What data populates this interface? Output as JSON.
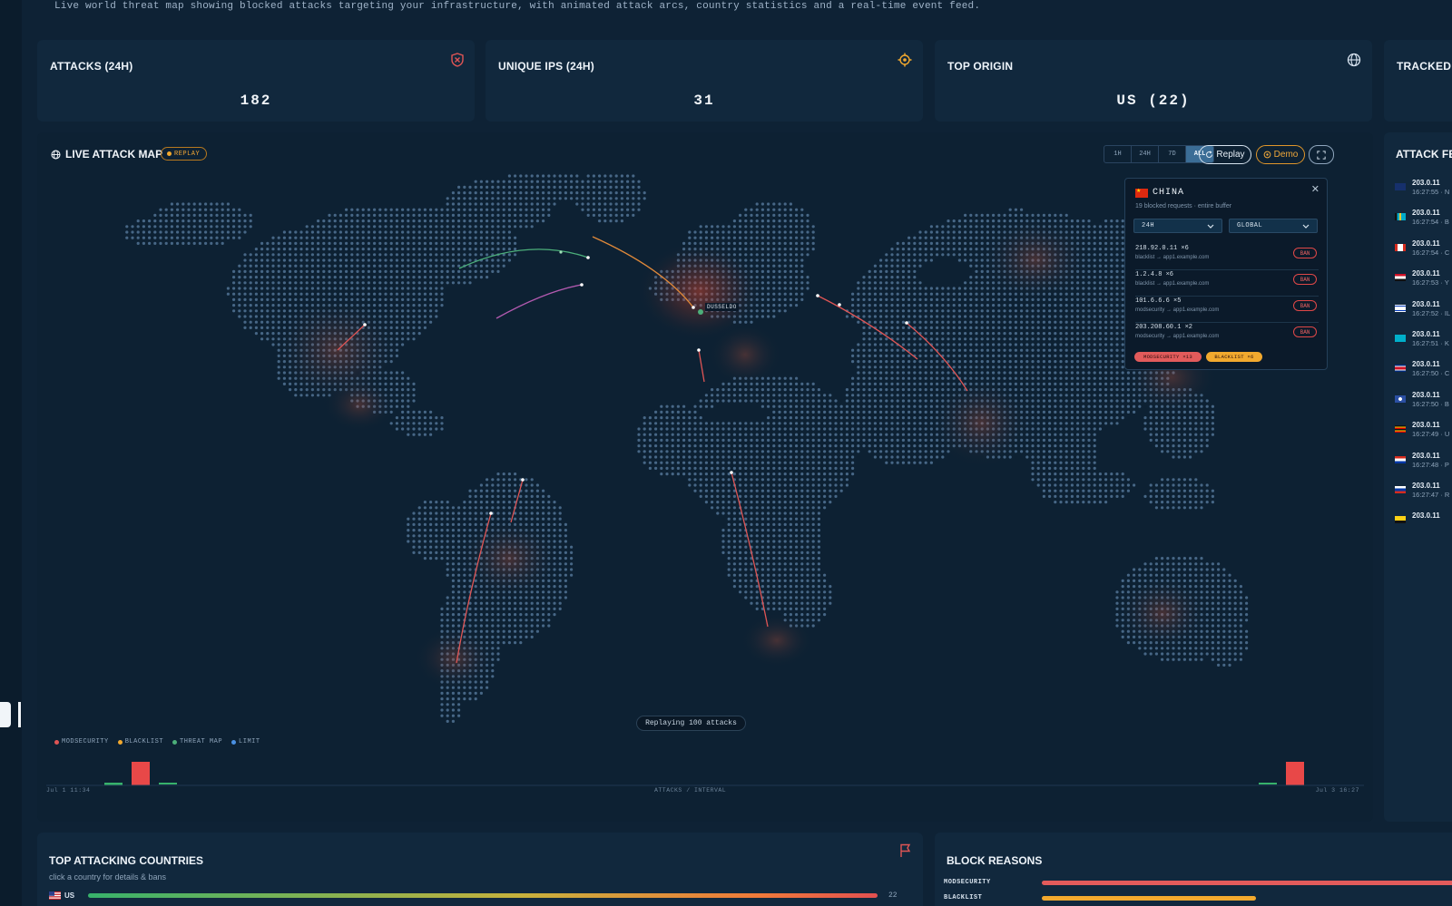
{
  "header": {
    "subtitle": "Live world threat map showing blocked attacks targeting your infrastructure, with animated attack arcs, country statistics and a real-time event feed."
  },
  "stats": [
    {
      "title": "ATTACKS (24H)",
      "value": "182",
      "icon": "shield-x-icon",
      "icon_color": "#e05555"
    },
    {
      "title": "UNIQUE IPS (24H)",
      "value": "31",
      "icon": "crosshair-icon",
      "icon_color": "#f2a92e"
    },
    {
      "title": "TOP ORIGIN",
      "value": "US (22)",
      "icon": "globe-icon",
      "icon_color": "#dbe6f2"
    },
    {
      "title": "TRACKED E",
      "value": "",
      "icon": "",
      "icon_color": ""
    }
  ],
  "map": {
    "title": "LIVE ATTACK MAP",
    "replay_badge": "REPLAY",
    "ranges": [
      {
        "label": "1H",
        "active": false
      },
      {
        "label": "24H",
        "active": false
      },
      {
        "label": "7D",
        "active": false
      },
      {
        "label": "ALL",
        "active": true
      }
    ],
    "replay_button": "Replay",
    "demo_button": "Demo",
    "replaying_text": "Replaying 100 attacks",
    "target_label": "DUSSELDO",
    "legend": [
      {
        "label": "MODSECURITY",
        "color": "#e05555"
      },
      {
        "label": "BLACKLIST",
        "color": "#f2a92e"
      },
      {
        "label": "THREAT MAP",
        "color": "#4caf7a"
      },
      {
        "label": "LIMIT",
        "color": "#4a90e2"
      }
    ],
    "axis": {
      "start": "Jul 1 11:34",
      "center": "ATTACKS / INTERVAL",
      "end": "Jul 3 16:27"
    },
    "histogram": {
      "left_bar": 8,
      "right_bar": 8
    }
  },
  "popup": {
    "country": "CHINA",
    "summary": "19 blocked requests · entire buffer",
    "time_select": "24H",
    "scope_select": "GLOBAL",
    "ban_label": "BAN",
    "rows": [
      {
        "ip": "218.92.0.11 ×6",
        "source": "blacklist → app1.example.com"
      },
      {
        "ip": "1.2.4.8 ×6",
        "source": "blacklist → app1.example.com"
      },
      {
        "ip": "101.6.6.6 ×5",
        "source": "modsecurity → app1.example.com"
      },
      {
        "ip": "203.208.60.1 ×2",
        "source": "modsecurity → app1.example.com"
      }
    ],
    "chips": [
      {
        "label": "MODSECURITY ×13",
        "color": "#e25b5b"
      },
      {
        "label": "BLACKLIST ×6",
        "color": "#f2a92e"
      }
    ]
  },
  "feed": {
    "title": "ATTACK FEE",
    "items": [
      {
        "ip": "203.0.11",
        "time": "16:27:55 · N",
        "flag": "alaska"
      },
      {
        "ip": "203.0.11",
        "time": "16:27:54 · B",
        "flag": "bahamas"
      },
      {
        "ip": "203.0.11",
        "time": "16:27:54 · C",
        "flag": "canada"
      },
      {
        "ip": "203.0.11",
        "time": "16:27:53 · Y",
        "flag": "yemen"
      },
      {
        "ip": "203.0.11",
        "time": "16:27:52 · IL",
        "flag": "israel"
      },
      {
        "ip": "203.0.11",
        "time": "16:27:51 · K",
        "flag": "kazakhstan"
      },
      {
        "ip": "203.0.11",
        "time": "16:27:50 · C",
        "flag": "costarica"
      },
      {
        "ip": "203.0.11",
        "time": "16:27:50 · B",
        "flag": "bluecircle"
      },
      {
        "ip": "203.0.11",
        "time": "16:27:49 · U",
        "flag": "uganda"
      },
      {
        "ip": "203.0.11",
        "time": "16:27:48 · P",
        "flag": "paraguay"
      },
      {
        "ip": "203.0.11",
        "time": "16:27:47 · R",
        "flag": "russia"
      },
      {
        "ip": "203.0.11",
        "time": "",
        "flag": "yellow"
      }
    ]
  },
  "top_countries": {
    "title": "TOP ATTACKING COUNTRIES",
    "subtitle": "click a country for details & bans",
    "rows": [
      {
        "code": "US",
        "value": "22"
      }
    ]
  },
  "block_reasons": {
    "title": "BLOCK REASONS",
    "rows": [
      {
        "label": "MODSECURITY",
        "color": "#e25b5b",
        "fraction": 1.0
      },
      {
        "label": "BLACKLIST",
        "color": "#f2a92e",
        "fraction": 0.49
      }
    ]
  }
}
